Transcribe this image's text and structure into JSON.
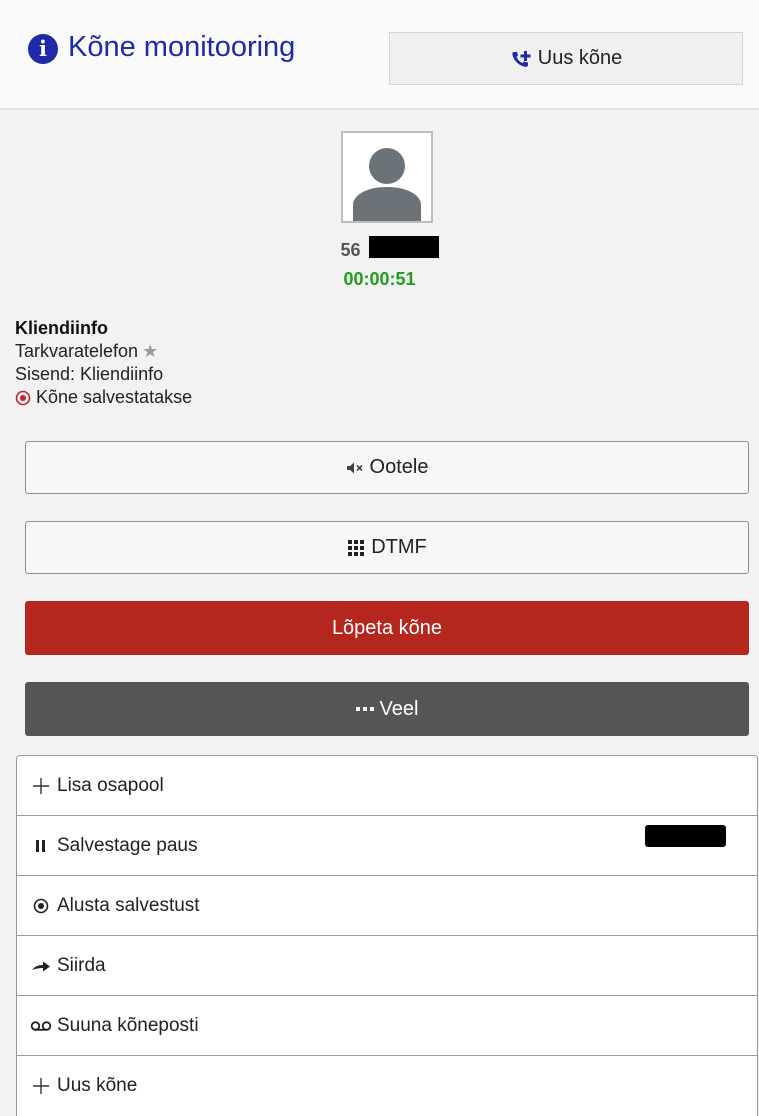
{
  "header": {
    "title": "Kõne monitooring",
    "new_call_label": "Uus kõne",
    "info_icon": "info-icon",
    "accent_color": "#1e2aa8"
  },
  "call": {
    "number": "56",
    "timer": "00:00:51",
    "timer_color": "#1e9e1e"
  },
  "client": {
    "heading": "Kliendiinfo",
    "device": "Tarkvaratelefon",
    "input": "Sisend: Kliendiinfo",
    "recording": "Kõne salvestatakse"
  },
  "buttons": {
    "hold": "Ootele",
    "dtmf": "DTMF",
    "end_call": "Lõpeta kõne",
    "more": "Veel"
  },
  "menu": {
    "add_party": "Lisa osapool",
    "pause_recording": "Salvestage paus",
    "start_recording": "Alusta salvestust",
    "transfer": "Siirda",
    "voicemail": "Suuna kõneposti",
    "new_call": "Uus kõne"
  },
  "colors": {
    "end_call": "#b5261e",
    "more": "#555555",
    "recording": "#c0262c"
  }
}
